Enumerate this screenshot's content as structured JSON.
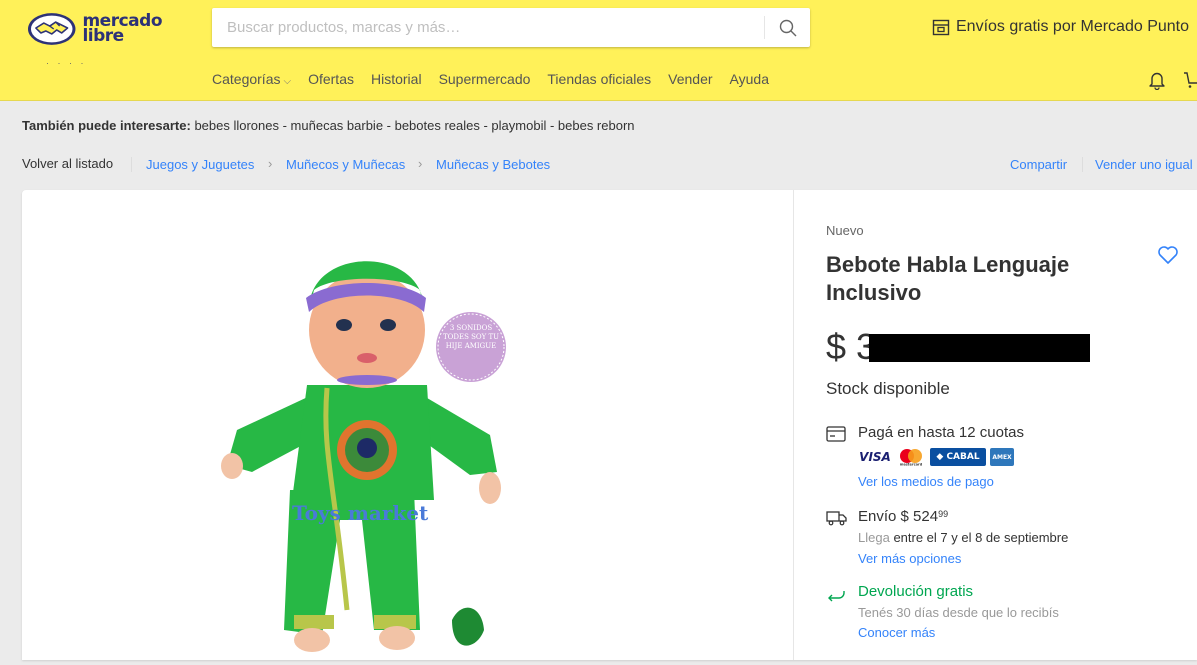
{
  "header": {
    "logo_line1": "mercado",
    "logo_line2": "libre",
    "search_placeholder": "Buscar productos, marcas y más…",
    "envios": "Envíos gratis por Mercado Punto",
    "nav": [
      "Categorías",
      "Ofertas",
      "Historial",
      "Supermercado",
      "Tiendas oficiales",
      "Vender",
      "Ayuda"
    ]
  },
  "suggest": {
    "label": "También puede interesarte:",
    "items": "bebes llorones - muñecas barbie - bebotes reales - playmobil - bebes reborn"
  },
  "breadcrumb": {
    "back": "Volver al listado",
    "items": [
      "Juegos y Juguetes",
      "Muñecos y Muñecas",
      "Muñecas y Bebotes"
    ],
    "share": "Compartir",
    "sell": "Vender uno igual"
  },
  "product": {
    "condition": "Nuevo",
    "title": "Bebote Habla Lenguaje Inclusivo",
    "price_symbol": "$",
    "price_partial": "3",
    "stock": "Stock disponible",
    "badge_text": "3 SONIDOS TODES SOY TU HIJE AMIGUE",
    "shirt_text": "Toys market"
  },
  "payment": {
    "title": "Pagá en hasta 12 cuotas",
    "brands": [
      "VISA",
      "mastercard",
      "CABAL",
      "AMEX"
    ],
    "link": "Ver los medios de pago"
  },
  "shipping": {
    "title_prefix": "Envío $ 524",
    "cents": "99",
    "arrival_prefix": "Llega",
    "arrival": "entre el 7 y el 8 de septiembre",
    "link": "Ver más opciones"
  },
  "returns": {
    "title": "Devolución gratis",
    "sub": "Tenés 30 días desde que lo recibís",
    "link": "Conocer más"
  },
  "colors": {
    "header_bg": "#fff159",
    "link": "#3483fa",
    "green": "#00a650",
    "logo_navy": "#2d3277"
  }
}
